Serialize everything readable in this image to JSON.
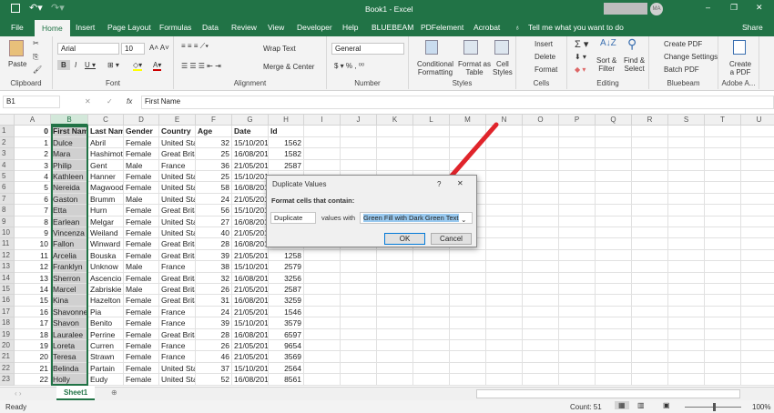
{
  "title_bar": {
    "title": "Book1 - Excel",
    "user_initials": "MA"
  },
  "tabs": [
    "File",
    "Home",
    "Insert",
    "Page Layout",
    "Formulas",
    "Data",
    "Review",
    "View",
    "Developer",
    "Help",
    "BLUEBEAM",
    "PDFelement",
    "Acrobat"
  ],
  "active_tab": "Home",
  "tell_me": "Tell me what you want to do",
  "share": "Share",
  "ribbon": {
    "clipboard": {
      "label": "Clipboard",
      "paste": "Paste"
    },
    "font": {
      "label": "Font",
      "name": "Arial",
      "size": "10"
    },
    "alignment": {
      "label": "Alignment",
      "wrap": "Wrap Text",
      "merge": "Merge & Center"
    },
    "number": {
      "label": "Number",
      "format": "General"
    },
    "styles": {
      "label": "Styles",
      "cond1": "Conditional",
      "cond2": "Formatting",
      "fmt1": "Format as",
      "fmt2": "Table",
      "cell1": "Cell",
      "cell2": "Styles"
    },
    "cells": {
      "label": "Cells",
      "insert": "Insert",
      "delete": "Delete",
      "format": "Format"
    },
    "editing": {
      "label": "Editing",
      "sort1": "Sort &",
      "sort2": "Filter",
      "find1": "Find &",
      "find2": "Select"
    },
    "bluebeam": {
      "label": "Bluebeam",
      "create": "Create PDF",
      "change": "Change Settings",
      "batch": "Batch PDF"
    },
    "adobe": {
      "label": "Adobe A...",
      "c1": "Create",
      "c2": "a PDF"
    }
  },
  "formula_bar": {
    "name_box": "B1",
    "fx": "fx",
    "content": "First Name"
  },
  "columns": [
    "A",
    "B",
    "C",
    "D",
    "E",
    "F",
    "G",
    "H",
    "I",
    "J",
    "K",
    "L",
    "M",
    "N",
    "O",
    "P",
    "Q",
    "R",
    "S",
    "T",
    "U"
  ],
  "rows": [
    [
      "0",
      "First Nam",
      "Last Nam",
      "Gender",
      "Country",
      "Age",
      "Date",
      "Id"
    ],
    [
      "1",
      "Dulce",
      "Abril",
      "Female",
      "United Sta",
      "32",
      "15/10/2017",
      "1562"
    ],
    [
      "2",
      "Mara",
      "Hashimoto",
      "Female",
      "Great Brita",
      "25",
      "16/08/2016",
      "1582"
    ],
    [
      "3",
      "Philip",
      "Gent",
      "Male",
      "France",
      "36",
      "21/05/2015",
      "2587"
    ],
    [
      "4",
      "Kathleen",
      "Hanner",
      "Female",
      "United Sta",
      "25",
      "15/10/2017",
      ""
    ],
    [
      "5",
      "Nereida",
      "Magwood",
      "Female",
      "United Sta",
      "58",
      "16/08/2016",
      ""
    ],
    [
      "6",
      "Gaston",
      "Brumm",
      "Male",
      "United Sta",
      "24",
      "21/05/2015",
      ""
    ],
    [
      "7",
      "Etta",
      "Hurn",
      "Female",
      "Great Brita",
      "56",
      "15/10/2017",
      ""
    ],
    [
      "8",
      "Earlean",
      "Melgar",
      "Female",
      "United Sta",
      "27",
      "16/08/2016",
      ""
    ],
    [
      "9",
      "Vincenza",
      "Weiland",
      "Female",
      "United Sta",
      "40",
      "21/05/2015",
      ""
    ],
    [
      "10",
      "Fallon",
      "Winward",
      "Female",
      "Great Brita",
      "28",
      "16/08/2016",
      ""
    ],
    [
      "11",
      "Arcelia",
      "Bouska",
      "Female",
      "Great Brita",
      "39",
      "21/05/2015",
      "1258"
    ],
    [
      "12",
      "Franklyn",
      "Unknow",
      "Male",
      "France",
      "38",
      "15/10/2017",
      "2579"
    ],
    [
      "13",
      "Sherron",
      "Ascencio",
      "Female",
      "Great Brita",
      "32",
      "16/08/2016",
      "3256"
    ],
    [
      "14",
      "Marcel",
      "Zabriskie",
      "Male",
      "Great Brita",
      "26",
      "21/05/2015",
      "2587"
    ],
    [
      "15",
      "Kina",
      "Hazelton",
      "Female",
      "Great Brita",
      "31",
      "16/08/2016",
      "3259"
    ],
    [
      "16",
      "Shavonne",
      "Pia",
      "Female",
      "France",
      "24",
      "21/05/2015",
      "1546"
    ],
    [
      "17",
      "Shavon",
      "Benito",
      "Female",
      "France",
      "39",
      "15/10/2017",
      "3579"
    ],
    [
      "18",
      "Lauralee",
      "Perrine",
      "Female",
      "Great Brita",
      "28",
      "16/08/2016",
      "6597"
    ],
    [
      "19",
      "Loreta",
      "Curren",
      "Female",
      "France",
      "26",
      "21/05/2015",
      "9654"
    ],
    [
      "20",
      "Teresa",
      "Strawn",
      "Female",
      "France",
      "46",
      "21/05/2015",
      "3569"
    ],
    [
      "21",
      "Belinda",
      "Partain",
      "Female",
      "United Sta",
      "37",
      "15/10/2017",
      "2564"
    ],
    [
      "22",
      "Holly",
      "Eudy",
      "Female",
      "United Sta",
      "52",
      "16/08/2016",
      "8561"
    ]
  ],
  "sheet_tab": "Sheet1",
  "status": {
    "ready": "Ready",
    "count": "Count: 51",
    "zoom": "100%"
  },
  "dialog": {
    "title": "Duplicate Values",
    "help": "?",
    "prompt": "Format cells that contain:",
    "type": "Duplicate",
    "values_with": "values with",
    "format": "Green Fill with Dark Green Text",
    "ok": "OK",
    "cancel": "Cancel"
  },
  "colors": {
    "excel_green": "#217346",
    "arrow": "#e0242b"
  }
}
